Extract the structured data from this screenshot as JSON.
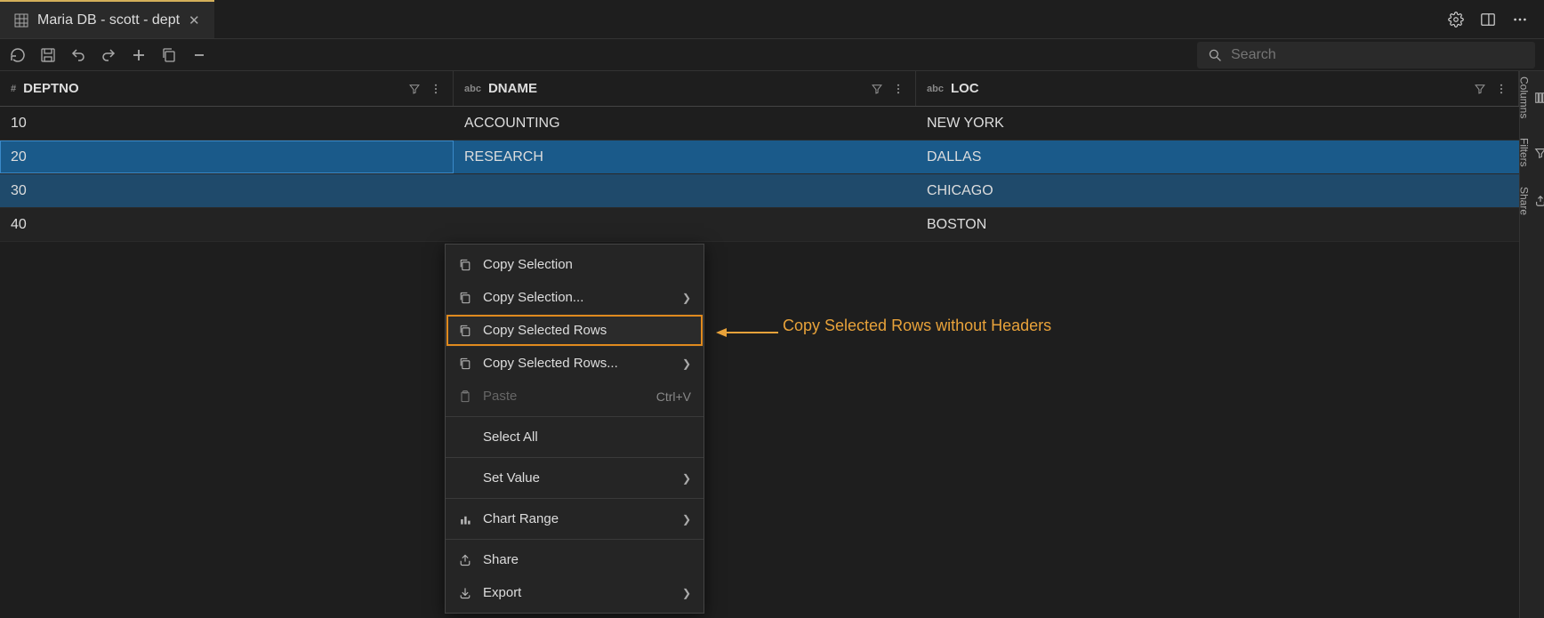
{
  "tab": {
    "title": "Maria DB - scott - dept"
  },
  "search": {
    "placeholder": "Search"
  },
  "columns": [
    {
      "name": "DEPTNO",
      "type": "#"
    },
    {
      "name": "DNAME",
      "type": "abc"
    },
    {
      "name": "LOC",
      "type": "abc"
    }
  ],
  "rows": [
    {
      "deptno": "10",
      "dname": "ACCOUNTING",
      "loc": "NEW YORK"
    },
    {
      "deptno": "20",
      "dname": "RESEARCH",
      "loc": "DALLAS"
    },
    {
      "deptno": "30",
      "dname": "",
      "loc": "CHICAGO"
    },
    {
      "deptno": "40",
      "dname": "",
      "loc": "BOSTON"
    }
  ],
  "context_menu": {
    "items": [
      {
        "label": "Copy Selection"
      },
      {
        "label": "Copy Selection..."
      },
      {
        "label": "Copy Selected Rows"
      },
      {
        "label": "Copy Selected Rows..."
      },
      {
        "label": "Paste",
        "shortcut": "Ctrl+V"
      },
      {
        "label": "Select All"
      },
      {
        "label": "Set Value"
      },
      {
        "label": "Chart Range"
      },
      {
        "label": "Share"
      },
      {
        "label": "Export"
      }
    ]
  },
  "annotation": {
    "text": "Copy Selected Rows without Headers"
  },
  "side_tabs": {
    "columns": "Columns",
    "filters": "Filters",
    "share": "Share"
  }
}
